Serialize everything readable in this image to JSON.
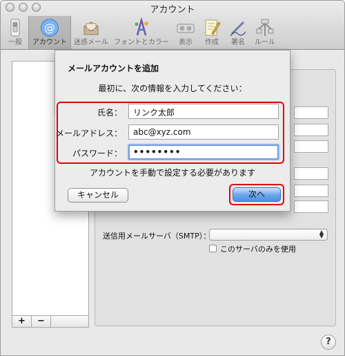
{
  "window": {
    "title": "アカウント"
  },
  "toolbar": {
    "items": [
      {
        "label": "一般",
        "icon": "light-switch-icon"
      },
      {
        "label": "アカウント",
        "icon": "at-sign-icon"
      },
      {
        "label": "迷惑メール",
        "icon": "junk-mail-icon"
      },
      {
        "label": "フォントとカラー",
        "icon": "font-color-icon"
      },
      {
        "label": "表示",
        "icon": "display-glasses-icon"
      },
      {
        "label": "作成",
        "icon": "compose-pencil-icon"
      },
      {
        "label": "署名",
        "icon": "signature-pen-icon"
      },
      {
        "label": "ルール",
        "icon": "rules-icon"
      }
    ]
  },
  "sheet": {
    "title": "メールアカウントを追加",
    "subtitle": "最初に、次の情報を入力してください：",
    "fields": [
      {
        "label": "氏名：",
        "value": "リンク太郎"
      },
      {
        "label": "メールアドレス：",
        "value": "abc@xyz.com"
      },
      {
        "label": "パスワード：",
        "value": "••••••••"
      }
    ],
    "manual_note": "アカウントを手動で設定する必要があります",
    "cancel_label": "キャンセル",
    "next_label": "次へ"
  },
  "background": {
    "smtp_label": "送信用メールサーバ（SMTP）：",
    "only_this_server_label": "このサーバのみを使用",
    "add_label": "+",
    "remove_label": "−",
    "help_label": "?"
  },
  "colors": {
    "highlight_frame": "#e20000",
    "focus_ring": "#6d9be3",
    "default_button": "#4a8fe6"
  }
}
